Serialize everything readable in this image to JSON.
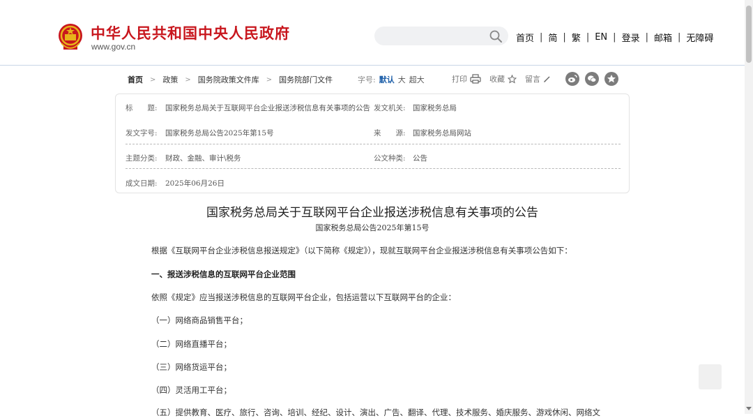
{
  "header": {
    "site_title": "中华人民共和国中央人民政府",
    "site_domain": "www.gov.cn",
    "search": {
      "placeholder": "",
      "value": ""
    },
    "nav": [
      "首页",
      "简",
      "繁",
      "EN",
      "登录",
      "邮箱",
      "无障碍"
    ],
    "separator": "|",
    "brand_color": "#c8161d"
  },
  "breadcrumb": {
    "items": [
      "首页",
      "政策",
      "国务院政策文件库",
      "国务院部门文件"
    ],
    "arrow": ">"
  },
  "font_size": {
    "label": "字号:",
    "options": [
      "默认",
      "大",
      "超大"
    ],
    "selected": "默认"
  },
  "tools": {
    "print": "打印",
    "favorite": "收藏",
    "comment": "留言"
  },
  "share_icons": [
    "weibo-icon",
    "wechat-icon",
    "star-icon"
  ],
  "info": {
    "rows": [
      [
        {
          "label": "标　　题:",
          "value": "国家税务总局关于互联网平台企业报送涉税信息有关事项的公告"
        },
        {
          "label": "发文机关:",
          "value": "国家税务总局"
        }
      ],
      [
        {
          "label": "发文字号:",
          "value": "国家税务总局公告2025年第15号"
        },
        {
          "label": "来　　源:",
          "value": "国家税务总局网站"
        }
      ],
      [
        {
          "label": "主题分类:",
          "value": "财政、金融、审计\\税务"
        },
        {
          "label": "公文种类:",
          "value": "公告"
        }
      ],
      [
        {
          "label": "成文日期:",
          "value": "2025年06月26日"
        },
        {
          "label": "",
          "value": ""
        }
      ]
    ]
  },
  "article": {
    "title": "国家税务总局关于互联网平台企业报送涉税信息有关事项的公告",
    "number": "国家税务总局公告2025年第15号",
    "paragraphs": [
      {
        "text": "根据《互联网平台企业涉税信息报送规定》（以下简称《规定》），现就互联网平台企业报送涉税信息有关事项公告如下：",
        "bold": false
      },
      {
        "text": "一、报送涉税信息的互联网平台企业范围",
        "bold": true
      },
      {
        "text": "依照《规定》应当报送涉税信息的互联网平台企业，包括运营以下互联网平台的企业：",
        "bold": false
      },
      {
        "text": "（一）网络商品销售平台；",
        "bold": false
      },
      {
        "text": "（二）网络直播平台；",
        "bold": false
      },
      {
        "text": "（三）网络货运平台；",
        "bold": false
      },
      {
        "text": "（四）灵活用工平台；",
        "bold": false
      },
      {
        "text": "（五）提供教育、医疗、旅行、咨询、培训、经纪、设计、演出、广告、翻译、代理、技术服务、婚庆服务、游戏休闲、网络文",
        "bold": false
      }
    ]
  }
}
